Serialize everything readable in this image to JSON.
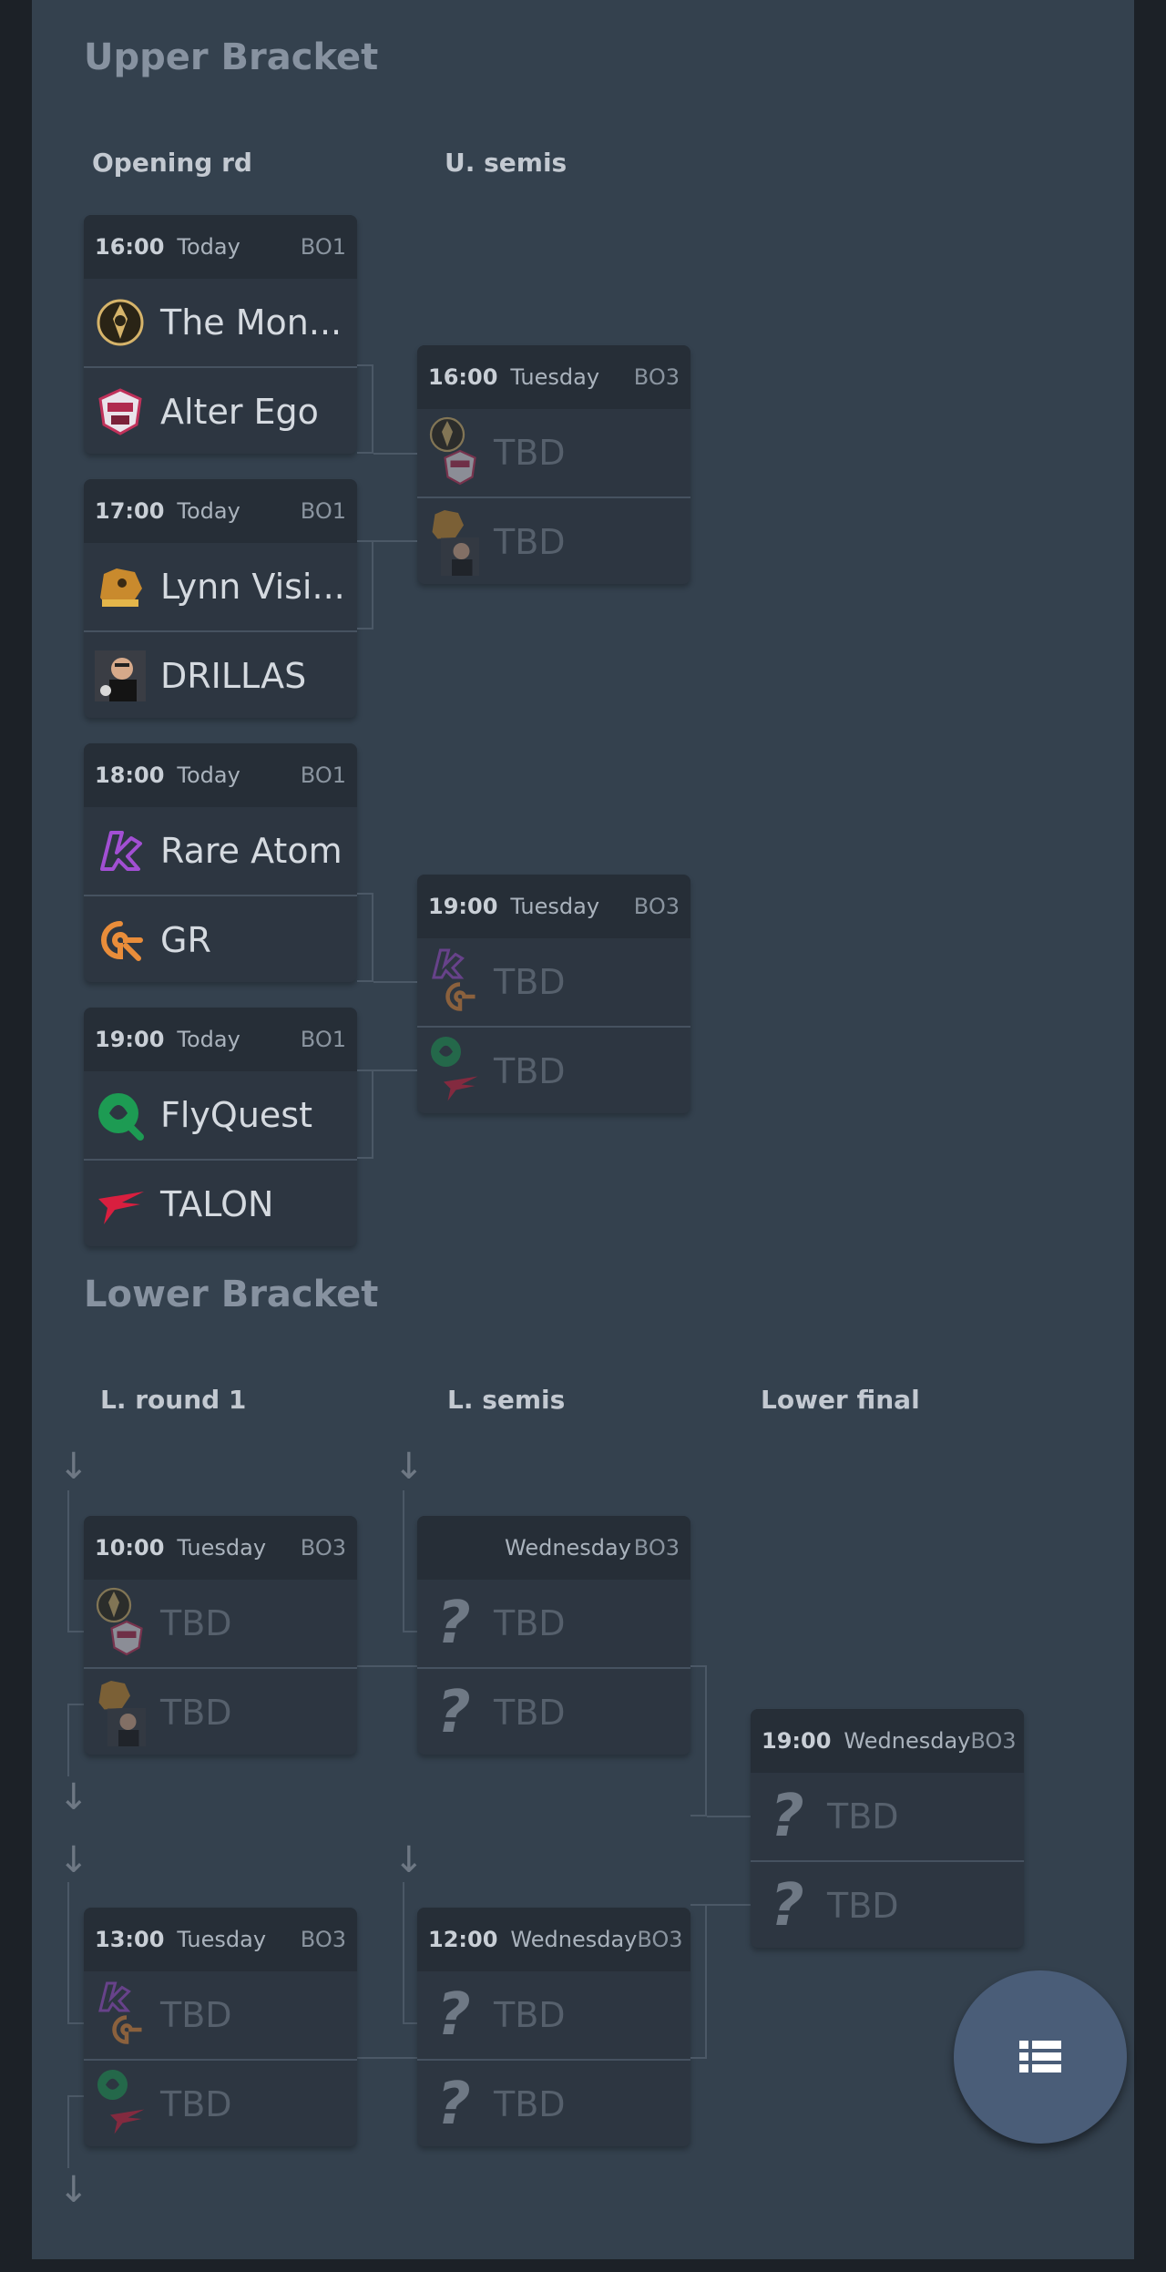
{
  "upper": {
    "title": "Upper Bracket",
    "col_opening": "Opening rd",
    "col_semis": "U. semis",
    "opening": [
      {
        "time": "16:00",
        "day": "Today",
        "format": "BO1",
        "team1": "The Mon...",
        "team2": "Alter Ego"
      },
      {
        "time": "17:00",
        "day": "Today",
        "format": "BO1",
        "team1": "Lynn Visi...",
        "team2": "DRILLAS"
      },
      {
        "time": "18:00",
        "day": "Today",
        "format": "BO1",
        "team1": "Rare Atom",
        "team2": "GR"
      },
      {
        "time": "19:00",
        "day": "Today",
        "format": "BO1",
        "team1": "FlyQuest",
        "team2": "TALON"
      }
    ],
    "semis": [
      {
        "time": "16:00",
        "day": "Tuesday",
        "format": "BO3",
        "team1": "TBD",
        "team2": "TBD"
      },
      {
        "time": "19:00",
        "day": "Tuesday",
        "format": "BO3",
        "team1": "TBD",
        "team2": "TBD"
      }
    ]
  },
  "lower": {
    "title": "Lower Bracket",
    "col_round1": "L. round 1",
    "col_semis": "L. semis",
    "col_final": "Lower final",
    "round1": [
      {
        "time": "10:00",
        "day": "Tuesday",
        "format": "BO3",
        "team1": "TBD",
        "team2": "TBD"
      },
      {
        "time": "13:00",
        "day": "Tuesday",
        "format": "BO3",
        "team1": "TBD",
        "team2": "TBD"
      }
    ],
    "semis": [
      {
        "time": "",
        "day": "Wednesday",
        "format": "BO3",
        "team1": "TBD",
        "team2": "TBD"
      },
      {
        "time": "12:00",
        "day": "Wednesday",
        "format": "BO3",
        "team1": "TBD",
        "team2": "TBD"
      }
    ],
    "final": {
      "time": "19:00",
      "day": "Wednesday",
      "format": "BO3",
      "team1": "TBD",
      "team2": "TBD"
    }
  },
  "fab": {
    "icon": "list-icon"
  },
  "colors": {
    "background": "#34414e",
    "card": "#2d3641",
    "card_header": "#262e37",
    "fab": "#4a5d78"
  }
}
